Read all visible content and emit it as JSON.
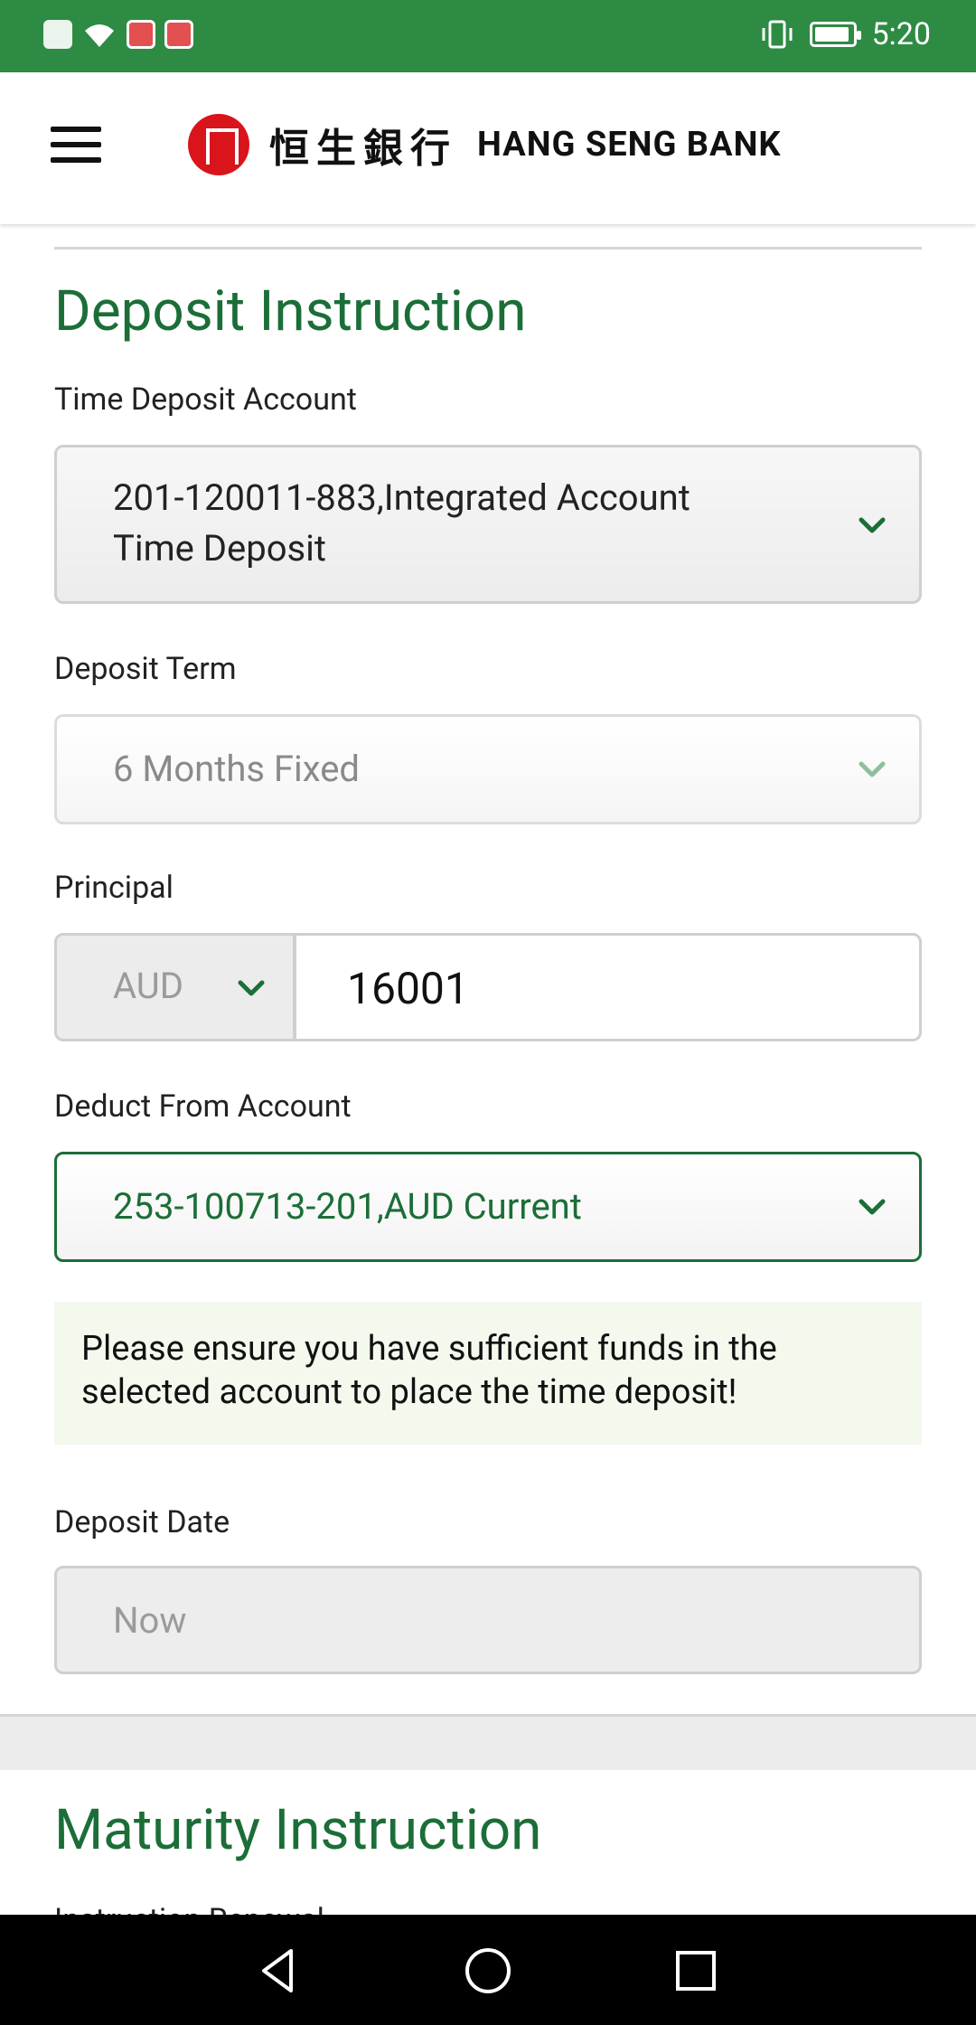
{
  "status_bar": {
    "time": "5:20"
  },
  "header": {
    "brand_cn": "恒生銀行",
    "brand_en": "HANG SENG BANK"
  },
  "deposit": {
    "title": "Deposit Instruction",
    "time_deposit_account": {
      "label": "Time Deposit Account",
      "value_line1": "201-120011-883,Integrated Account",
      "value_line2": "Time Deposit"
    },
    "deposit_term": {
      "label": "Deposit Term",
      "value": "6 Months Fixed"
    },
    "principal": {
      "label": "Principal",
      "currency": "AUD",
      "amount": "16001"
    },
    "deduct_from": {
      "label": "Deduct From Account",
      "value": "253-100713-201,AUD Current"
    },
    "notice": "Please ensure you have sufficient funds in the selected account to place the time deposit!",
    "deposit_date": {
      "label": "Deposit Date",
      "value": "Now"
    }
  },
  "maturity": {
    "title": "Maturity Instruction",
    "next_label": "Instruction Renewal"
  },
  "colors": {
    "brand_green": "#1b6e37",
    "status_green": "#2e8b43",
    "logo_red": "#d9141b"
  }
}
